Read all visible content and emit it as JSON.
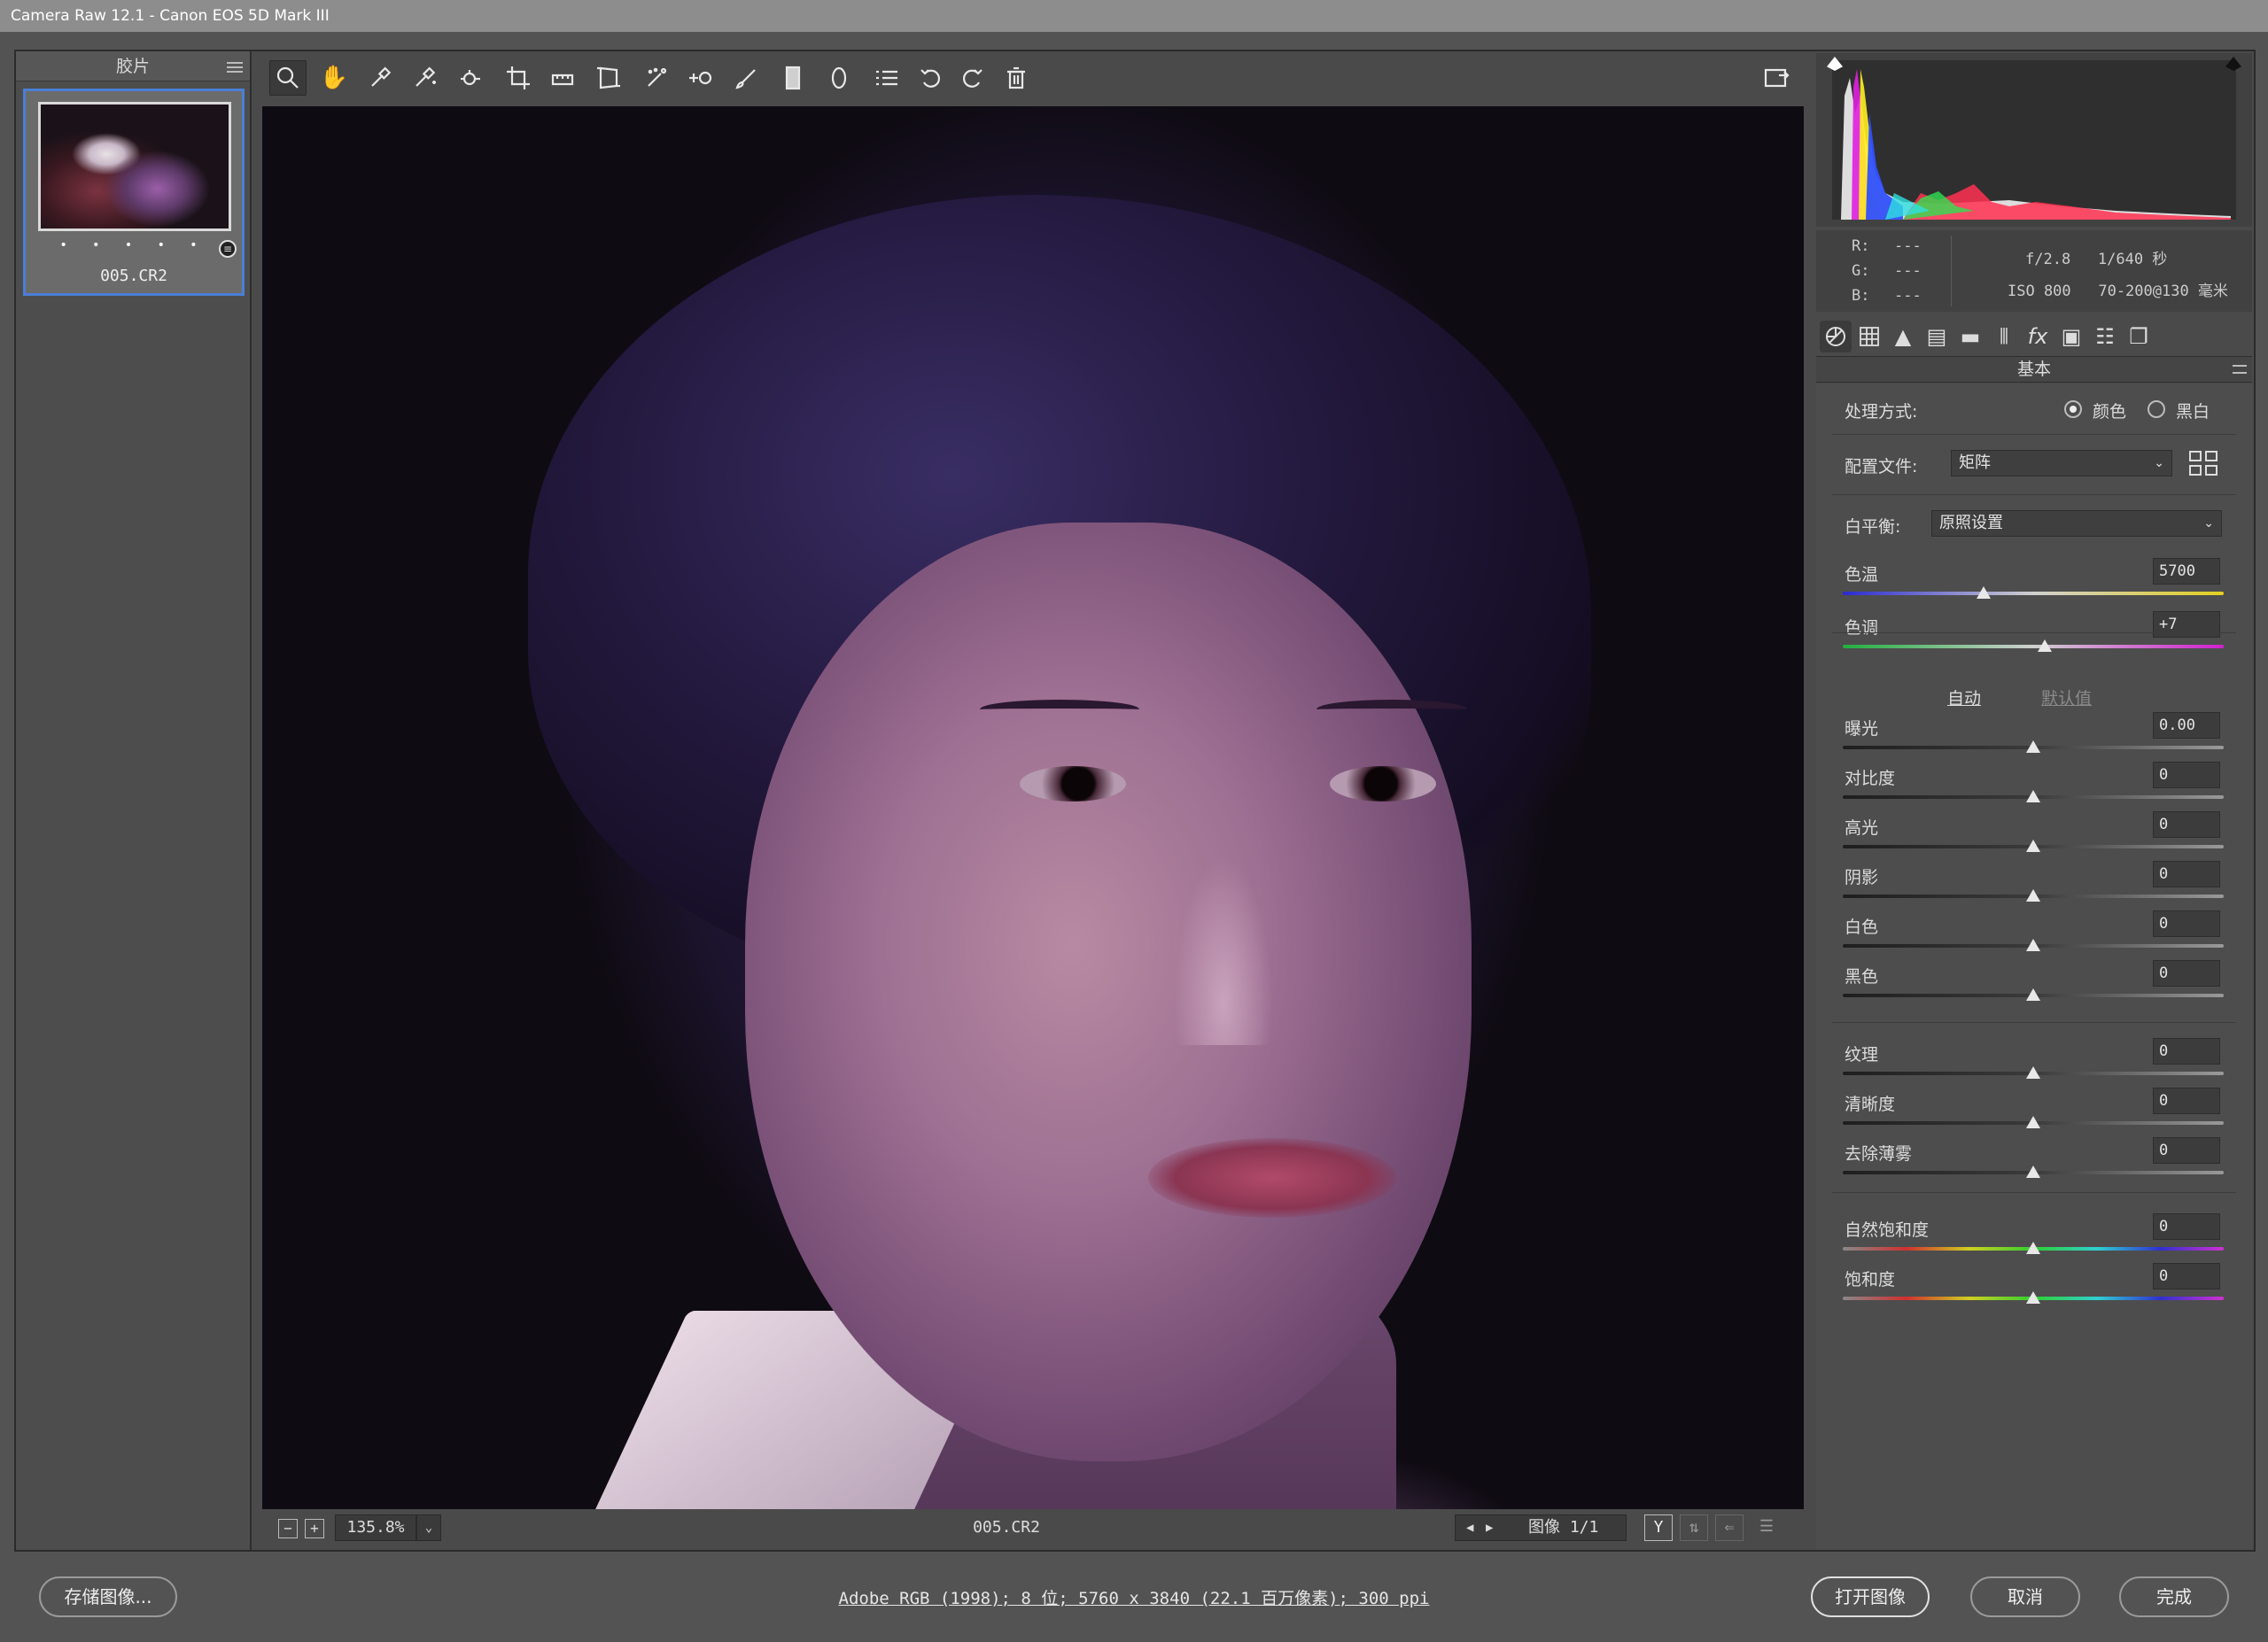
{
  "window": {
    "title": "Camera Raw 12.1 -  Canon EOS 5D Mark III"
  },
  "filmstrip": {
    "title": "胶片",
    "thumbnail": {
      "filename": "005.CR2",
      "stars": "• • • • •"
    }
  },
  "toolbar": {
    "tools": [
      "zoom-icon",
      "hand-icon",
      "white-balance-icon",
      "color-sampler-icon",
      "targeted-adjustment-icon",
      "crop-icon",
      "straighten-icon",
      "transform-icon",
      "spot-removal-icon",
      "red-eye-icon",
      "adjustment-brush-icon",
      "graduated-filter-icon",
      "radial-filter-icon",
      "presets-icon",
      "rotate-left-icon",
      "rotate-right-icon",
      "trash-icon"
    ],
    "fullscreen": "fullscreen-icon"
  },
  "status": {
    "zoom": "135.8%",
    "filename": "005.CR2",
    "image_counter": "图像 1/1"
  },
  "info": {
    "r_label": "R:",
    "g_label": "G:",
    "b_label": "B:",
    "r_value": "---",
    "g_value": "---",
    "b_value": "---",
    "aperture_shutter": "f/2.8   1/640 秒",
    "iso_lens": "ISO 800   70-200@130 毫米"
  },
  "panel": {
    "title": "基本",
    "treatment_label": "处理方式:",
    "treatment_color": "颜色",
    "treatment_bw": "黑白",
    "profile_label": "配置文件:",
    "profile_value": "矩阵",
    "wb_label": "白平衡:",
    "wb_value": "原照设置",
    "auto_link": "自动",
    "default_link": "默认值",
    "sliders": [
      {
        "label": "色温",
        "value": "5700",
        "position": 0.37
      },
      {
        "label": "色调",
        "value": "+7",
        "position": 0.53
      },
      {
        "label": "曝光",
        "value": "0.00",
        "position": 0.5
      },
      {
        "label": "对比度",
        "value": "0",
        "position": 0.5
      },
      {
        "label": "高光",
        "value": "0",
        "position": 0.5
      },
      {
        "label": "阴影",
        "value": "0",
        "position": 0.5
      },
      {
        "label": "白色",
        "value": "0",
        "position": 0.5
      },
      {
        "label": "黑色",
        "value": "0",
        "position": 0.5
      },
      {
        "label": "纹理",
        "value": "0",
        "position": 0.5
      },
      {
        "label": "清晰度",
        "value": "0",
        "position": 0.5
      },
      {
        "label": "去除薄雾",
        "value": "0",
        "position": 0.5
      },
      {
        "label": "自然饱和度",
        "value": "0",
        "position": 0.5
      },
      {
        "label": "饱和度",
        "value": "0",
        "position": 0.5
      }
    ]
  },
  "bottom": {
    "save_label": "存储图像...",
    "workflow": "Adobe RGB (1998); 8 位; 5760 x 3840 (22.1 百万像素); 300 ppi",
    "open_label": "打开图像",
    "cancel_label": "取消",
    "done_label": "完成"
  },
  "colors": {
    "accent": "#4a7fd6",
    "panel_bg": "#4d4d4d",
    "chrome_bg": "#535353"
  }
}
